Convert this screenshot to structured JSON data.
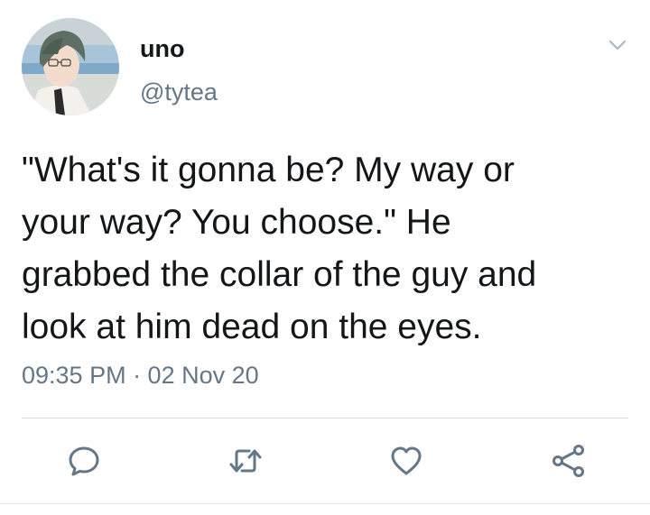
{
  "tweet": {
    "author": {
      "display_name": "uno",
      "handle": "@tytea",
      "avatar_icon": "anime-character-avatar"
    },
    "text": "\"What's it gonna be? My way or\nyour way?  You choose.\" He\ngrabbed the collar of the guy and\nlook at him dead on the eyes.",
    "timestamp": "09:35 PM · 02 Nov 20",
    "menu_icon": "chevron-down-icon",
    "actions": [
      {
        "name": "reply",
        "icon": "reply-icon"
      },
      {
        "name": "retweet",
        "icon": "retweet-icon"
      },
      {
        "name": "like",
        "icon": "heart-icon"
      },
      {
        "name": "share",
        "icon": "share-icon"
      }
    ]
  },
  "colors": {
    "text_primary": "#14171a",
    "text_secondary": "#657786",
    "icon": "#657786",
    "divider": "#d9dde1",
    "background": "#ffffff"
  }
}
